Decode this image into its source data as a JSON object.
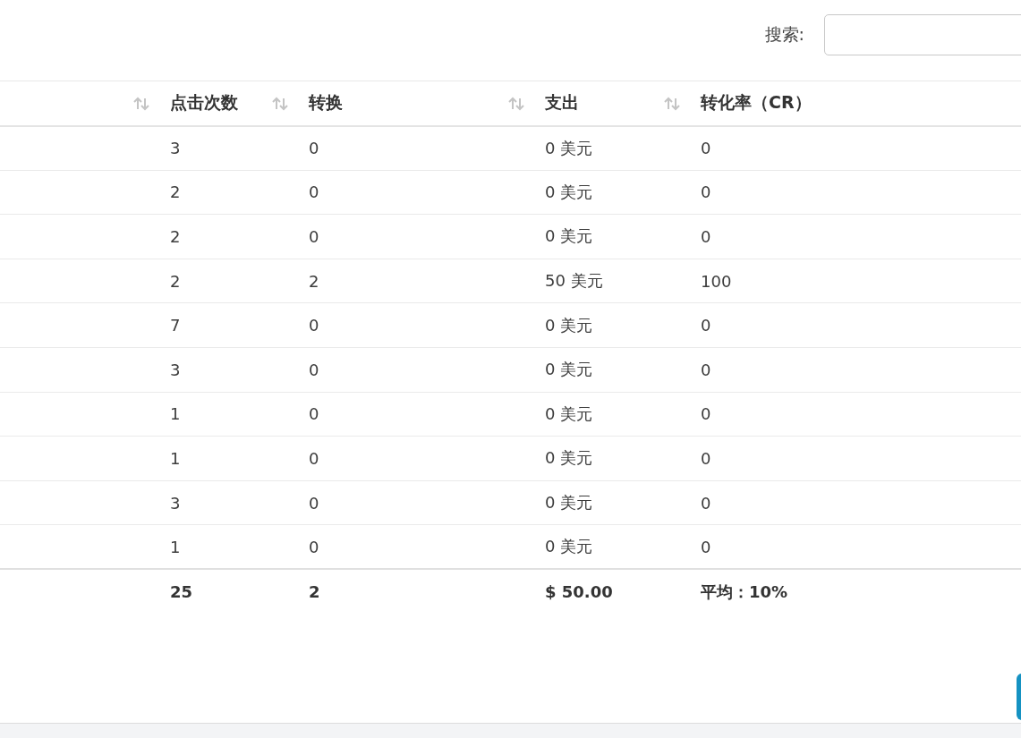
{
  "search": {
    "label": "搜索:"
  },
  "table": {
    "columns": [
      {
        "sortable": true
      },
      {
        "label": "点击次数",
        "sortable": true
      },
      {
        "label": "转换",
        "sortable": true
      },
      {
        "label": "支出",
        "sortable": true
      },
      {
        "label": "转化率（CR）",
        "sortable": false
      }
    ],
    "rows": [
      [
        "",
        "3",
        "0",
        "0 美元",
        "0"
      ],
      [
        "",
        "2",
        "0",
        "0 美元",
        "0"
      ],
      [
        "",
        "2",
        "0",
        "0 美元",
        "0"
      ],
      [
        "",
        "2",
        "2",
        "50 美元",
        "100"
      ],
      [
        "",
        "7",
        "0",
        "0 美元",
        "0"
      ],
      [
        "",
        "3",
        "0",
        "0 美元",
        "0"
      ],
      [
        "",
        "1",
        "0",
        "0 美元",
        "0"
      ],
      [
        "",
        "1",
        "0",
        "0 美元",
        "0"
      ],
      [
        "",
        "3",
        "0",
        "0 美元",
        "0"
      ],
      [
        "",
        "1",
        "0",
        "0 美元",
        "0"
      ]
    ],
    "totals": [
      "25",
      "2",
      "$ 50.00",
      "平均：10%"
    ]
  }
}
